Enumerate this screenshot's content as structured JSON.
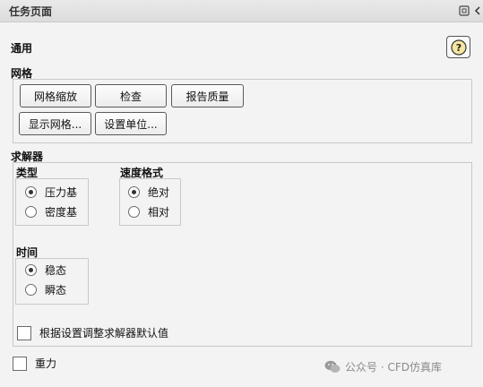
{
  "panel": {
    "title": "任务页面"
  },
  "general": {
    "label": "通用",
    "help_symbol": "?"
  },
  "mesh": {
    "label": "网格",
    "buttons": {
      "scale": "网格缩放",
      "check": "检查",
      "report_quality": "报告质量",
      "display_mesh": "显示网格...",
      "set_units": "设置单位..."
    }
  },
  "solver": {
    "label": "求解器",
    "type": {
      "label": "类型",
      "options": [
        {
          "label": "压力基",
          "checked": true
        },
        {
          "label": "密度基",
          "checked": false
        }
      ]
    },
    "velocity_formulation": {
      "label": "速度格式",
      "options": [
        {
          "label": "绝对",
          "checked": true
        },
        {
          "label": "相对",
          "checked": false
        }
      ]
    },
    "time": {
      "label": "时间",
      "options": [
        {
          "label": "稳态",
          "checked": true
        },
        {
          "label": "瞬态",
          "checked": false
        }
      ]
    },
    "adjust_defaults": {
      "label": "根据设置调整求解器默认值",
      "checked": false
    }
  },
  "gravity": {
    "label": "重力",
    "checked": false
  },
  "watermark": {
    "text": "公众号 · CFD仿真库"
  }
}
